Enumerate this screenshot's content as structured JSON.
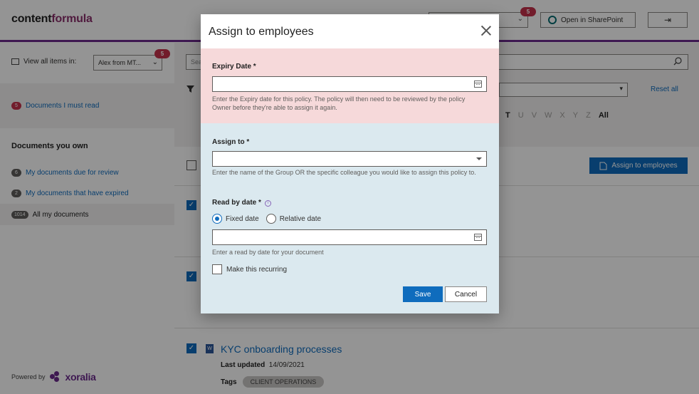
{
  "header": {
    "brand_part1": "content",
    "brand_part2": "formula",
    "badge_count": "5",
    "open_sharepoint": "Open in SharePoint"
  },
  "sidebar": {
    "view_all_label": "View all items in:",
    "view_select_value": "Alex from MT...",
    "view_badge": "5",
    "must_read": {
      "count": "5",
      "label": "Documents I must read"
    },
    "heading": "Documents you own",
    "items": [
      {
        "count": "6",
        "label": "My documents due for review"
      },
      {
        "count": "2",
        "label": "My documents that have expired"
      },
      {
        "count": "1014",
        "label": "All my documents"
      }
    ],
    "powered_by": "Powered by",
    "powered_brand": "xoralia"
  },
  "main": {
    "search_placeholder": "Sea",
    "reset_all": "Reset all",
    "alphabet": [
      "T",
      "U",
      "V",
      "W",
      "X",
      "Y",
      "Z"
    ],
    "alphabet_all": "All",
    "assign_button": "Assign to employees",
    "document": {
      "title": "KYC onboarding processes",
      "last_updated_label": "Last updated",
      "last_updated_value": "14/09/2021",
      "tags_label": "Tags",
      "tag": "CLIENT OPERATIONS"
    }
  },
  "modal": {
    "title": "Assign to employees",
    "expiry_label": "Expiry Date *",
    "expiry_value": "",
    "expiry_help": "Enter the Expiry date for this policy. The policy will then need to be reviewed by the policy Owner before they're able to assign it again.",
    "assign_label": "Assign to *",
    "assign_value": "",
    "assign_help": "Enter the name of the Group OR the specific colleague you would like to assign this policy to.",
    "read_by_label": "Read by date *",
    "radio_fixed": "Fixed date",
    "radio_relative": "Relative date",
    "read_by_value": "",
    "read_by_help": "Enter a read by date for your document",
    "recurring_label": "Make this recurring",
    "save": "Save",
    "cancel": "Cancel"
  },
  "colors": {
    "accent": "#0f6cbd",
    "brand_purple": "#6b2a8c",
    "expiry_bg": "#f6d9da",
    "assign_bg": "#dbe9ef",
    "badge_red": "#c4314b"
  }
}
